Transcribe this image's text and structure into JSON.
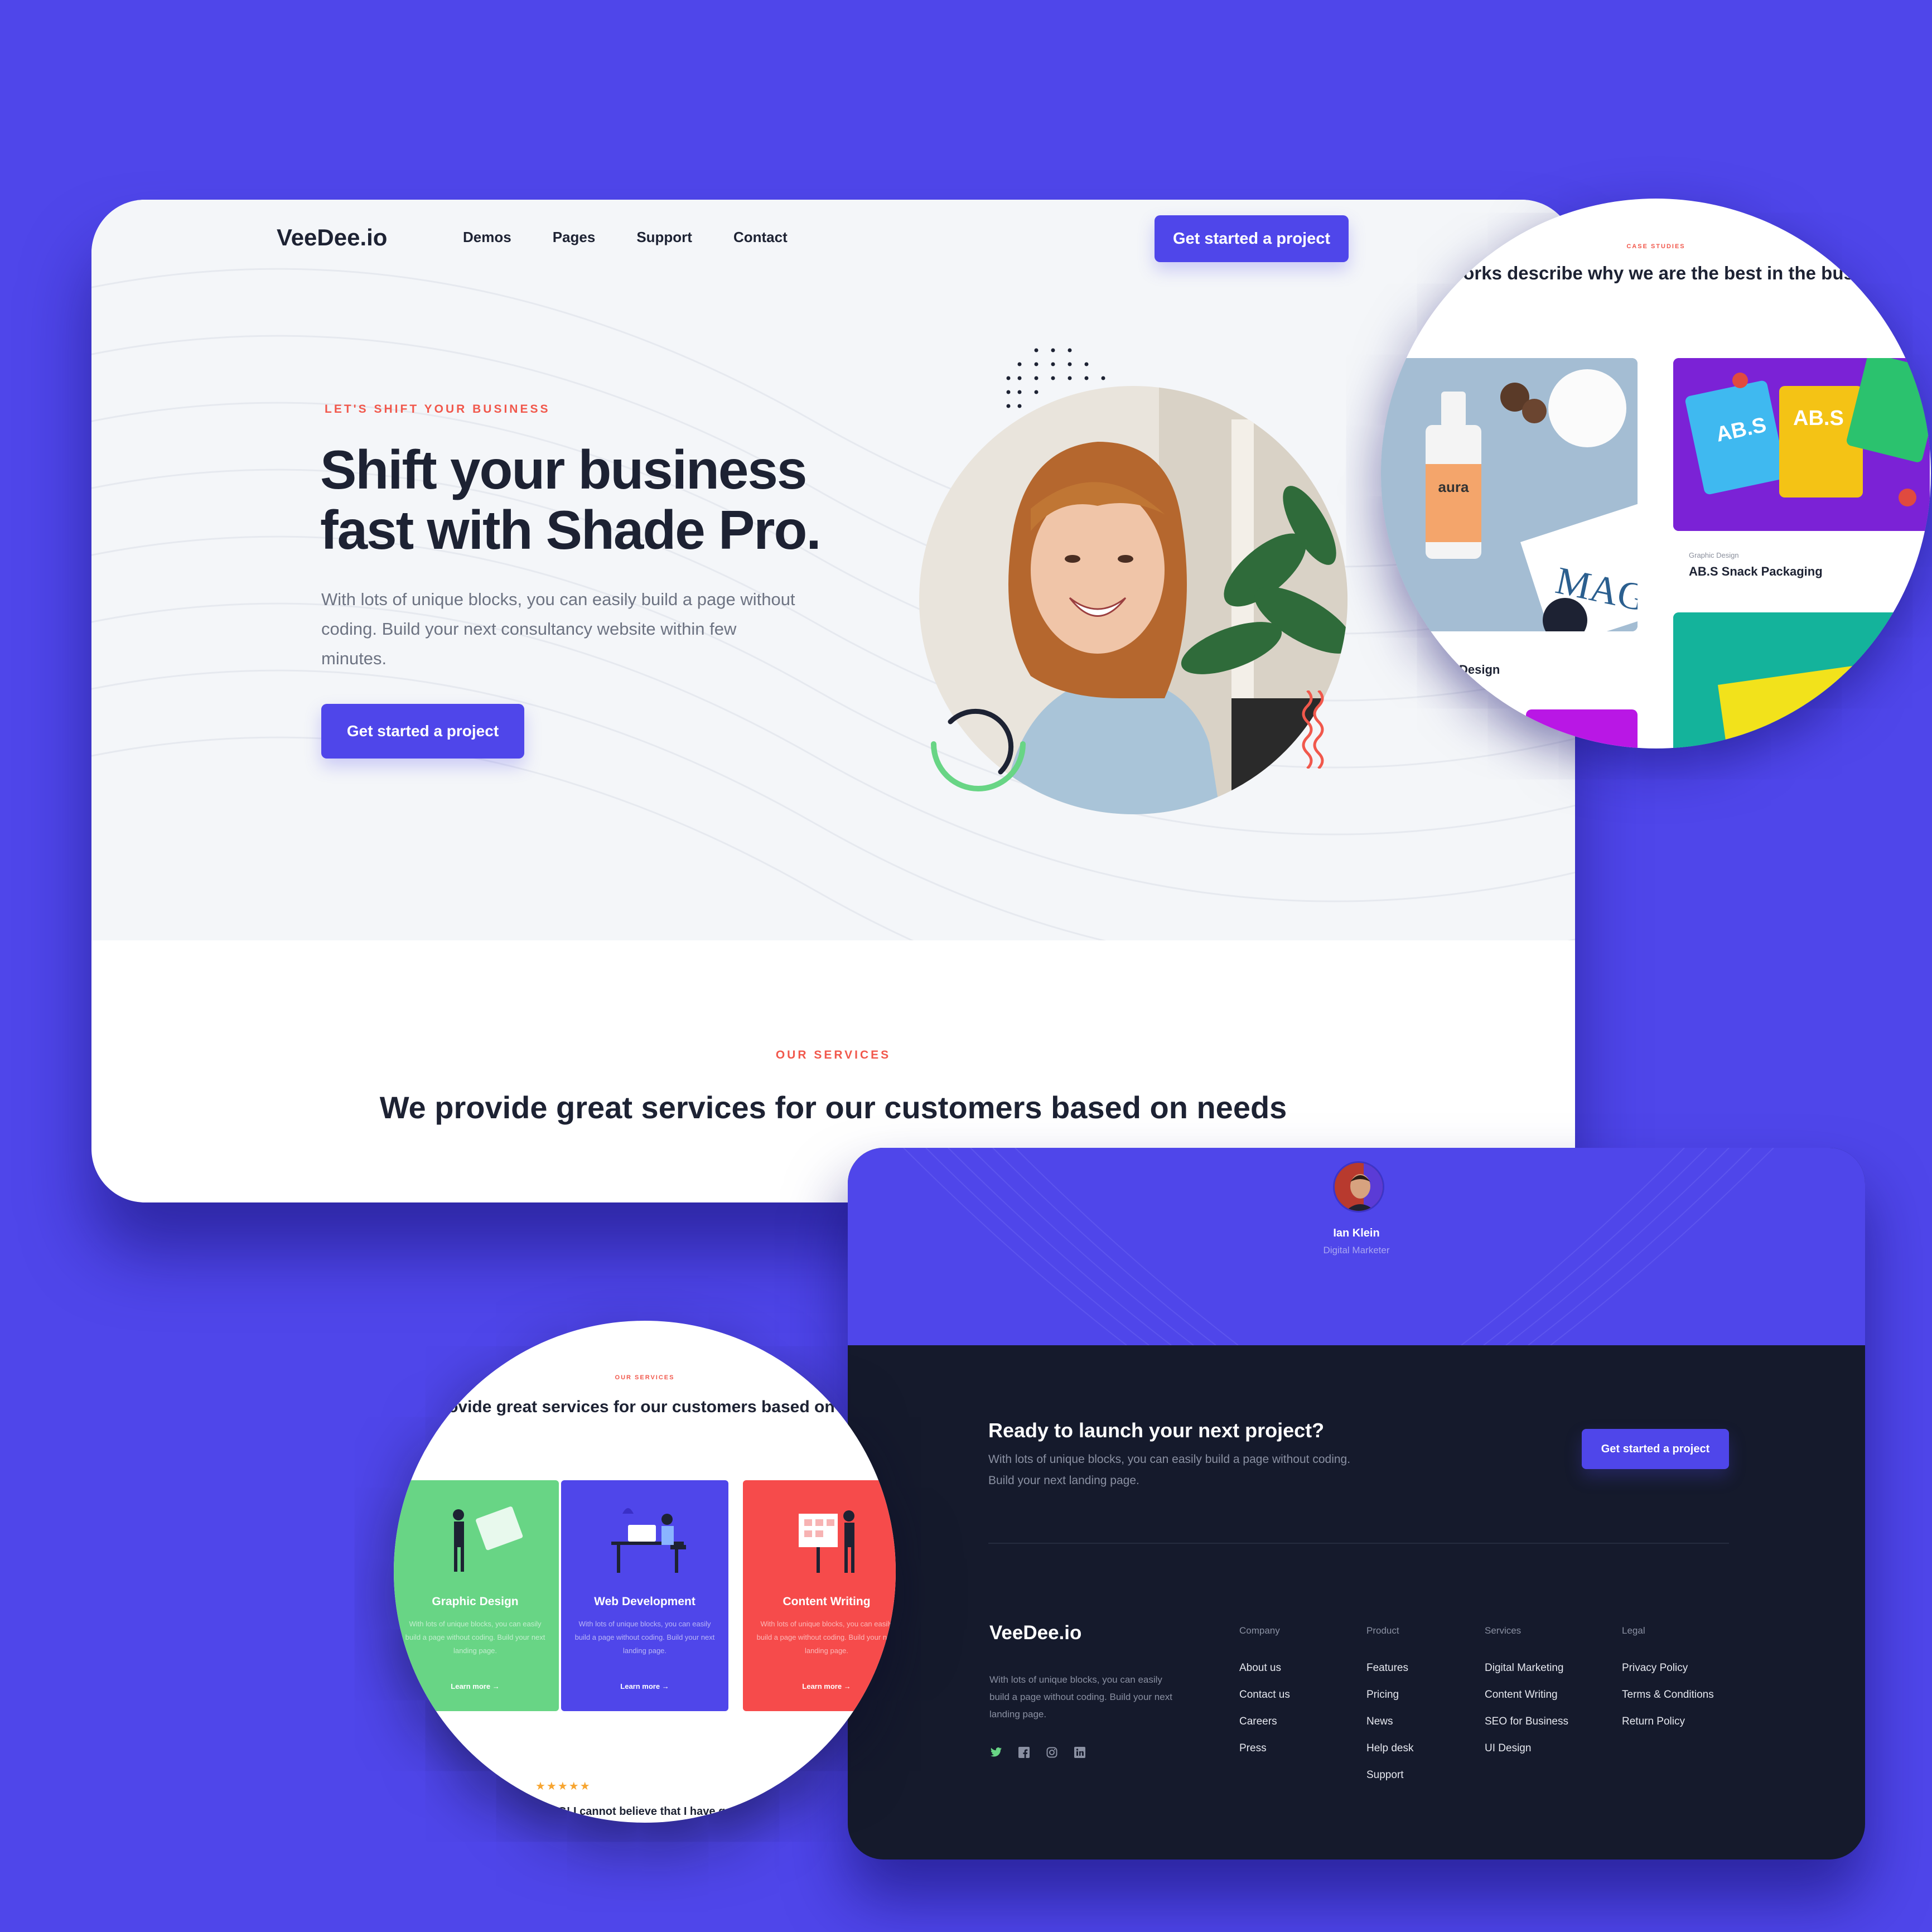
{
  "nav": {
    "logo": "VeeDee.io",
    "links": [
      "Demos",
      "Pages",
      "Support",
      "Contact"
    ],
    "cta": "Get started a project"
  },
  "hero": {
    "eyebrow": "LET'S SHIFT YOUR BUSINESS",
    "title": "Shift your business fast with Shade Pro.",
    "text": "With lots of unique blocks, you can easily build a page without coding. Build your next consultancy website within few minutes.",
    "cta": "Get started a project"
  },
  "services_section": {
    "eyebrow": "OUR SERVICES",
    "title": "We provide great services for our customers based on needs"
  },
  "case_studies": {
    "eyebrow": "CASE STUDIES",
    "title": "Our works describe why we are the best in the business",
    "items": [
      {
        "category": "Graphic Design",
        "name": "AB.S Snack Packaging"
      },
      {
        "name": "Design"
      }
    ],
    "aura_label": "aura",
    "mag_label": "MAG",
    "abs_label": "AB.S"
  },
  "testimonial": {
    "name": "Ian Klein",
    "role": "Digital Marketer"
  },
  "cta_section": {
    "title": "Ready to launch your next project?",
    "text": "With lots of unique blocks, you can easily build a page without coding. Build your next landing page.",
    "button": "Get started a project"
  },
  "footer": {
    "logo": "VeeDee.io",
    "description": "With lots of unique blocks, you can easily build a page without coding. Build your next landing page.",
    "social_icons": [
      "twitter-icon",
      "facebook-icon",
      "instagram-icon",
      "linkedin-icon"
    ],
    "columns": [
      {
        "heading": "Company",
        "links": [
          "About us",
          "Contact us",
          "Careers",
          "Press"
        ]
      },
      {
        "heading": "Product",
        "links": [
          "Features",
          "Pricing",
          "News",
          "Help desk",
          "Support"
        ]
      },
      {
        "heading": "Services",
        "links": [
          "Digital Marketing",
          "Content Writing",
          "SEO for Business",
          "UI Design"
        ]
      },
      {
        "heading": "Legal",
        "links": [
          "Privacy Policy",
          "Terms & Conditions",
          "Return Policy"
        ]
      }
    ]
  },
  "services_preview": {
    "eyebrow": "OUR SERVICES",
    "title": "We provide great services for our customers based on needs",
    "cards": [
      {
        "title": "Graphic Design",
        "text": "With lots of unique blocks, you can easily build a page without coding. Build your next landing page.",
        "link": "Learn more",
        "color": "#68d585"
      },
      {
        "title": "Web Development",
        "text": "With lots of unique blocks, you can easily build a page without coding. Build your next landing page.",
        "link": "Learn more",
        "color": "#4f46ea"
      },
      {
        "title": "Content Writing",
        "text": "With lots of unique blocks, you can easily build a page without coding. Build your next landing page.",
        "link": "Learn more",
        "color": "#f64b4b"
      }
    ],
    "stars": "★★★★★",
    "quote": "OMG! I cannot believe that I have got a brand new landing page after getting this. It was"
  },
  "colors": {
    "background": "#4f46ea",
    "accent": "#4f46ea",
    "eyebrow": "#f1584c",
    "dark": "#151a2c"
  }
}
